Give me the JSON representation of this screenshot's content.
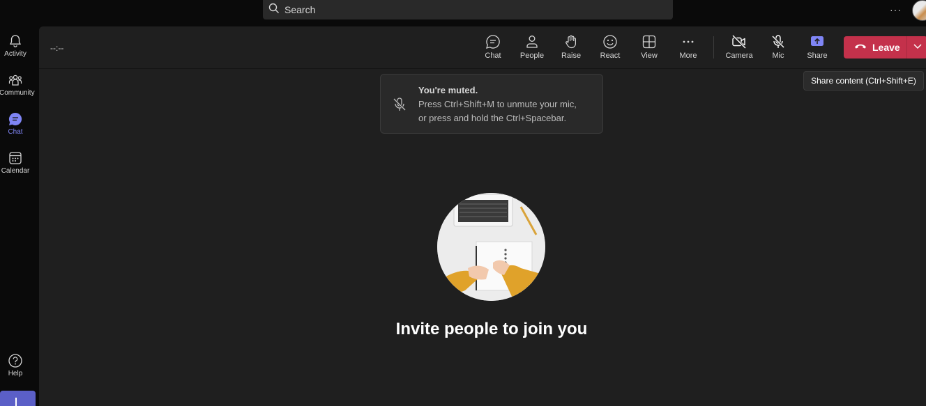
{
  "titlebar": {
    "search_label": "Search",
    "more_label": "···"
  },
  "rail": {
    "items": [
      {
        "label": "Activity",
        "icon": "bell-icon"
      },
      {
        "label": "Community",
        "icon": "community-icon"
      },
      {
        "label": "Chat",
        "icon": "chat-icon",
        "active": true
      },
      {
        "label": "Calendar",
        "icon": "calendar-icon"
      }
    ],
    "help_label": "Help"
  },
  "meeting": {
    "timer": "--:--",
    "controls": {
      "chat": "Chat",
      "people": "People",
      "raise": "Raise",
      "react": "React",
      "view": "View",
      "more": "More",
      "camera": "Camera",
      "mic": "Mic",
      "share": "Share"
    },
    "leave_label": "Leave",
    "tooltip": "Share content (Ctrl+Shift+E)",
    "toast": {
      "title": "You're muted.",
      "line1": "Press Ctrl+Shift+M to unmute your mic,",
      "line2": "or press and hold the Ctrl+Spacebar."
    },
    "invite_text": "Invite people to join you"
  },
  "colors": {
    "accent": "#7f85f5",
    "brand": "#5b5fc7",
    "leave": "#c4314b",
    "stage": "#1f1f1f",
    "shell": "#0a0a0a"
  }
}
